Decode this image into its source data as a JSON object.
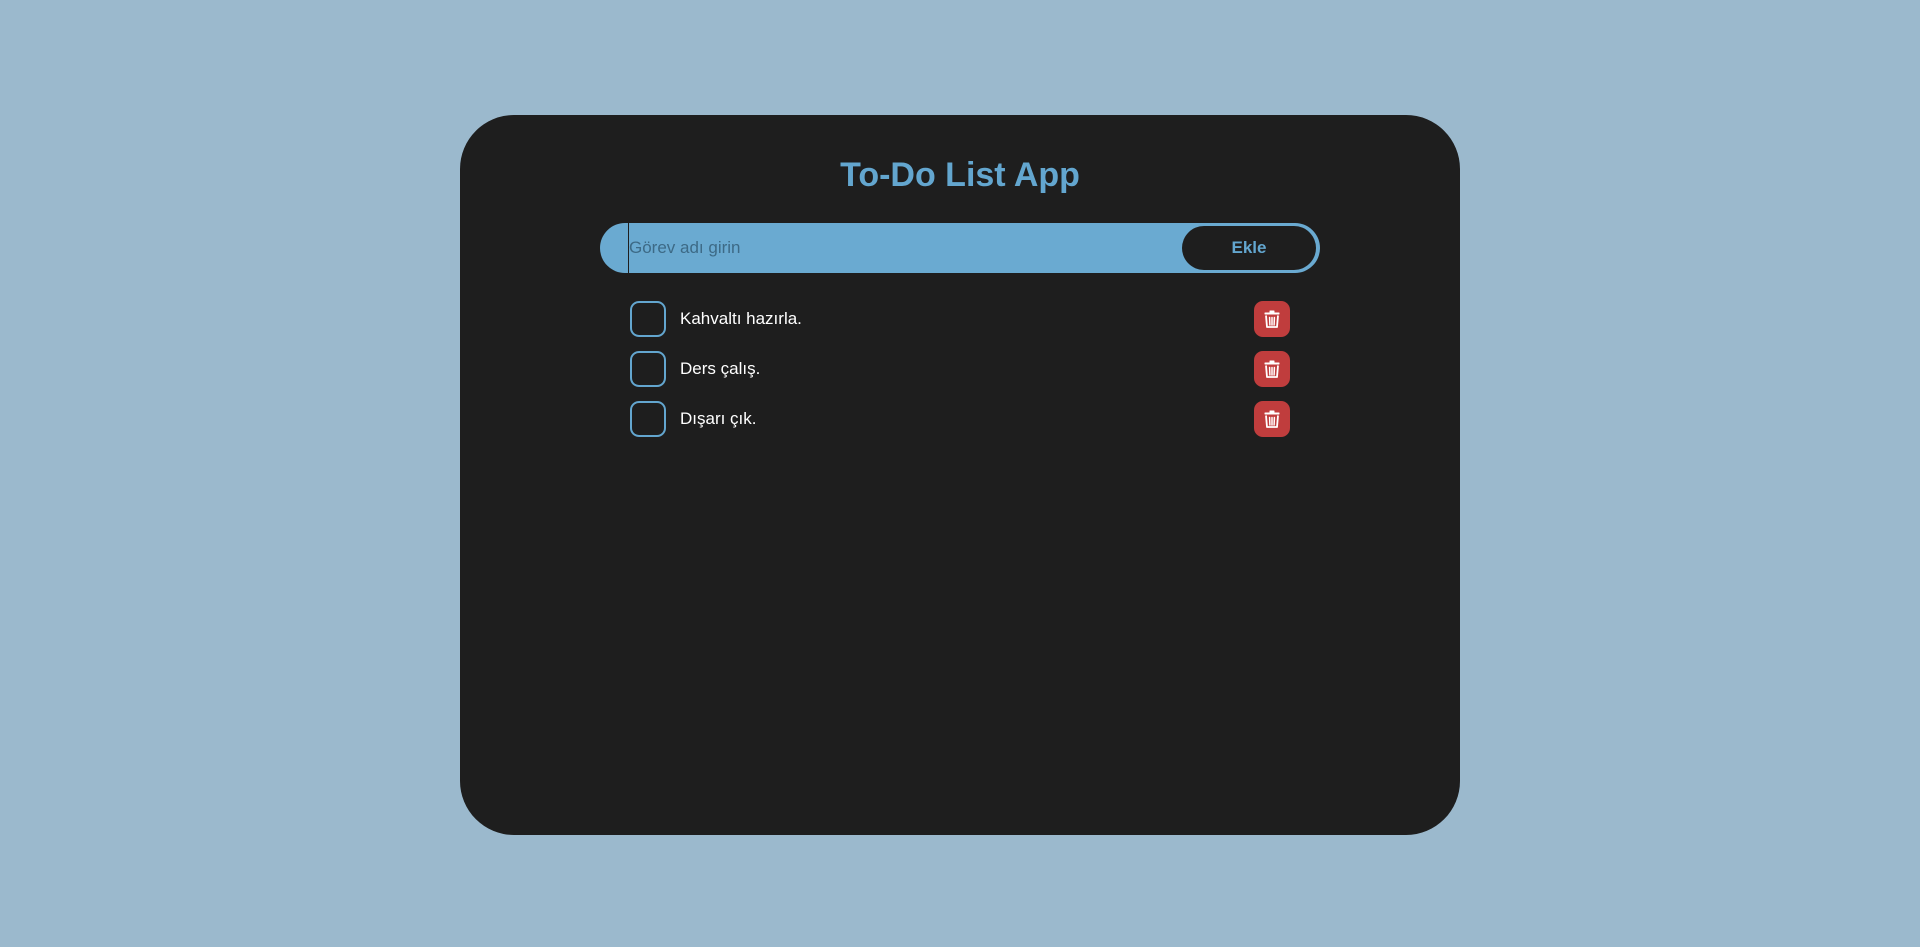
{
  "app": {
    "title": "To-Do List App"
  },
  "input": {
    "placeholder": "Görev adı girin",
    "value": ""
  },
  "add_button": {
    "label": "Ekle"
  },
  "tasks": [
    {
      "label": "Kahvaltı hazırla.",
      "checked": false
    },
    {
      "label": "Ders çalış.",
      "checked": false
    },
    {
      "label": "Dışarı çık.",
      "checked": false
    }
  ],
  "icons": {
    "delete": "trash-icon"
  },
  "colors": {
    "page_background": "#9bb9cd",
    "card_background": "#1e1e1e",
    "accent": "#63a6cf",
    "input_background": "#6aaad1",
    "delete": "#c03d3d",
    "task_text": "#ffffff"
  }
}
